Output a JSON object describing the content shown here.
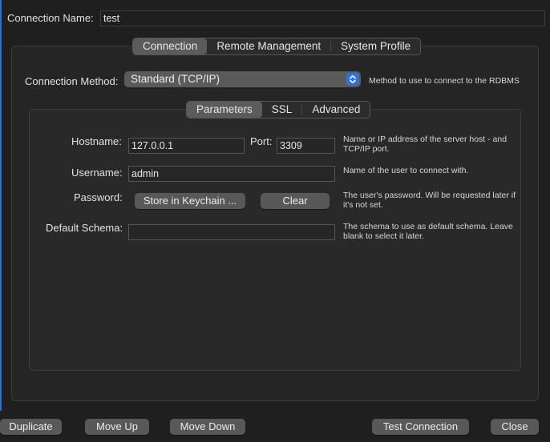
{
  "connection_name": {
    "label": "Connection Name:",
    "value": "test"
  },
  "main_tabs": [
    {
      "label": "Connection",
      "active": true
    },
    {
      "label": "Remote Management",
      "active": false
    },
    {
      "label": "System Profile",
      "active": false
    }
  ],
  "connection_method": {
    "label": "Connection Method:",
    "value": "Standard (TCP/IP)",
    "help": "Method to use to connect to the RDBMS"
  },
  "sub_tabs": [
    {
      "label": "Parameters",
      "active": true
    },
    {
      "label": "SSL",
      "active": false
    },
    {
      "label": "Advanced",
      "active": false
    }
  ],
  "parameters": {
    "hostname": {
      "label": "Hostname:",
      "value": "127.0.0.1",
      "help": "Name or IP address of the server host - and TCP/IP port."
    },
    "port": {
      "label": "Port:",
      "value": "3309"
    },
    "username": {
      "label": "Username:",
      "value": "admin",
      "help": "Name of the user to connect with."
    },
    "password": {
      "label": "Password:",
      "store_button": "Store in Keychain ...",
      "clear_button": "Clear",
      "help": "The user's password. Will be requested later if it's not set."
    },
    "default_schema": {
      "label": "Default Schema:",
      "value": "",
      "help": "The schema to use as default schema. Leave blank to select it later."
    }
  },
  "footer": {
    "duplicate": "Duplicate",
    "move_up": "Move Up",
    "move_down": "Move Down",
    "test_connection": "Test Connection",
    "close": "Close"
  },
  "colors": {
    "accent": "#2e6fd6",
    "background": "#1f1f1f",
    "button": "#585858"
  }
}
